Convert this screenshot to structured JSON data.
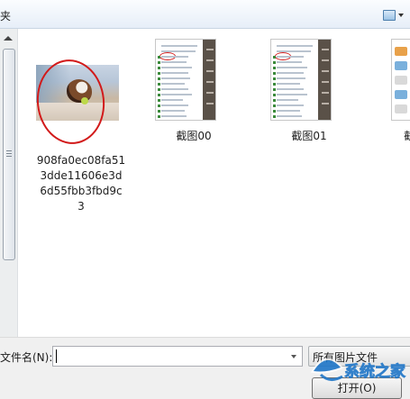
{
  "toolbar": {
    "crumb": "夹",
    "view_icon": "view-options-icon"
  },
  "files": [
    {
      "name": "908fa0ec08fa513dde11606e3d6d55fbb3fbd9c3",
      "caption_lines": [
        "908fa0ec08fa51",
        "3dde11606e3d",
        "6d55fbb3fbd9c",
        "3"
      ],
      "type": "photo",
      "annotated": true
    },
    {
      "name": "截图00",
      "type": "screenshot"
    },
    {
      "name": "截图01",
      "type": "screenshot"
    },
    {
      "name": "截",
      "type": "screenshot-partial"
    }
  ],
  "bottom": {
    "filename_label": "文件名(N):",
    "filename_value": "",
    "filter_label": "所有图片文件",
    "open_label": "打开(O)"
  },
  "watermark": {
    "text": "系统之家",
    "color": "#1f76c8"
  }
}
